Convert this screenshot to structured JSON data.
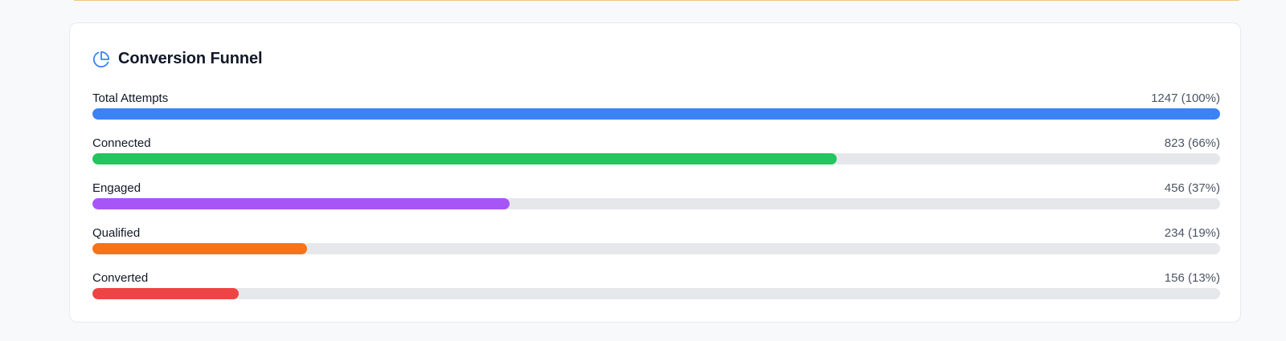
{
  "funnel": {
    "title": "Conversion Funnel",
    "icon": "pie-chart-icon",
    "accent": "#3b82f6",
    "stages": [
      {
        "label": "Total Attempts",
        "value_text": "1247 (100%)",
        "fraction": 1.0,
        "color": "#3b82f6"
      },
      {
        "label": "Connected",
        "value_text": "823 (66%)",
        "fraction": 0.66,
        "color": "#22c55e"
      },
      {
        "label": "Engaged",
        "value_text": "456 (37%)",
        "fraction": 0.37,
        "color": "#a855f7"
      },
      {
        "label": "Qualified",
        "value_text": "234 (19%)",
        "fraction": 0.19,
        "color": "#f97316"
      },
      {
        "label": "Converted",
        "value_text": "156 (13%)",
        "fraction": 0.13,
        "color": "#ef4444"
      }
    ],
    "track_color": "#e5e7eb"
  }
}
